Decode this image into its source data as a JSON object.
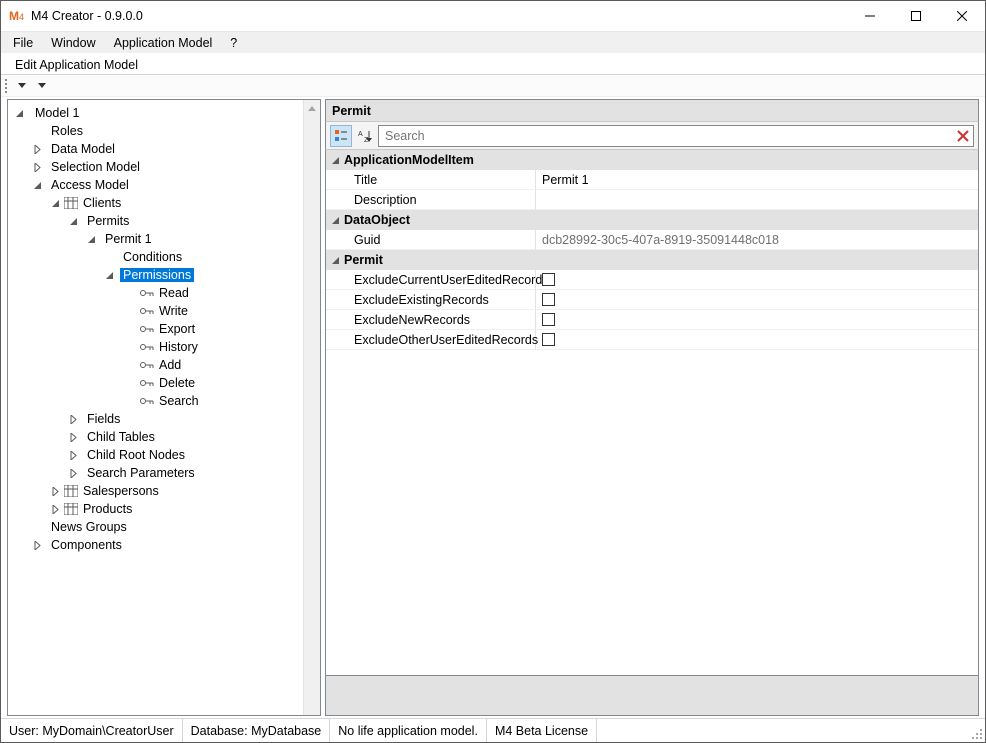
{
  "title": "M4 Creator - 0.9.0.0",
  "menu": {
    "file": "File",
    "window": "Window",
    "appmodel": "Application Model",
    "help": "?"
  },
  "tab": "Edit Application Model",
  "tree": {
    "model": "Model 1",
    "roles": "Roles",
    "datamodel": "Data Model",
    "selectionmodel": "Selection Model",
    "accessmodel": "Access Model",
    "clients": "Clients",
    "permits": "Permits",
    "permit1": "Permit 1",
    "conditions": "Conditions",
    "permissions": "Permissions",
    "read": "Read",
    "write": "Write",
    "export": "Export",
    "history": "History",
    "add": "Add",
    "delete": "Delete",
    "search": "Search",
    "fields": "Fields",
    "childtables": "Child Tables",
    "childrootnodes": "Child Root Nodes",
    "searchparams": "Search Parameters",
    "salespersons": "Salespersons",
    "products": "Products",
    "newsgroups": "News Groups",
    "components": "Components"
  },
  "panel": {
    "title": "Permit",
    "search_placeholder": "Search",
    "sections": {
      "ami": "ApplicationModelItem",
      "do": "DataObject",
      "permit": "Permit"
    },
    "props": {
      "title_name": "Title",
      "title_val": "Permit 1",
      "desc_name": "Description",
      "desc_val": "",
      "guid_name": "Guid",
      "guid_val": "dcb28992-30c5-407a-8919-35091448c018",
      "p1": "ExcludeCurrentUserEditedRecords",
      "p2": "ExcludeExistingRecords",
      "p3": "ExcludeNewRecords",
      "p4": "ExcludeOtherUserEditedRecords"
    }
  },
  "status": {
    "user": "User: MyDomain\\CreatorUser",
    "db": "Database: MyDatabase",
    "life": "No life application model.",
    "lic": "M4 Beta License"
  }
}
